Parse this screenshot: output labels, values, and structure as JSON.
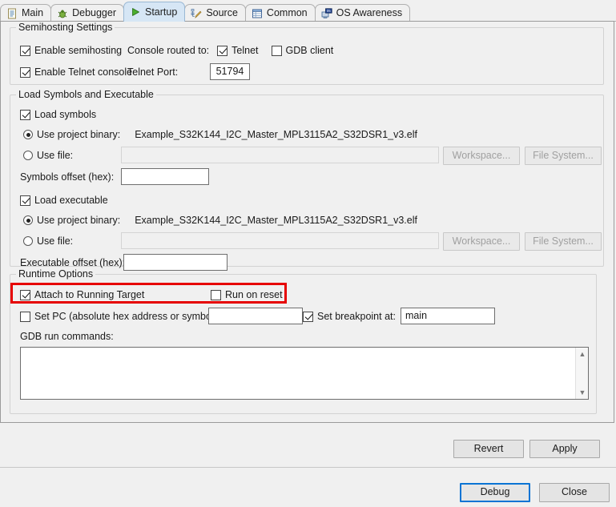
{
  "tabs": [
    {
      "label": "Main",
      "icon": "document-icon",
      "active": false
    },
    {
      "label": "Debugger",
      "icon": "bug-icon",
      "active": false
    },
    {
      "label": "Startup",
      "icon": "play-icon",
      "active": true
    },
    {
      "label": "Source",
      "icon": "source-edit-icon",
      "active": false
    },
    {
      "label": "Common",
      "icon": "table-icon",
      "active": false
    },
    {
      "label": "OS Awareness",
      "icon": "os-monitor-icon",
      "active": false
    }
  ],
  "semihosting": {
    "group_title": "Semihosting Settings",
    "enable_semihosting": {
      "label": "Enable semihosting",
      "checked": true
    },
    "enable_telnet_console": {
      "label": "Enable Telnet console",
      "checked": true
    },
    "console_routed_to_label": "Console routed to:",
    "telnet": {
      "label": "Telnet",
      "checked": true
    },
    "gdb_client": {
      "label": "GDB client",
      "checked": false
    },
    "telnet_port_label": "Telnet Port:",
    "telnet_port_value": "51794"
  },
  "load_symbols": {
    "group_title": "Load Symbols and Executable",
    "load_symbols": {
      "label": "Load symbols",
      "checked": true
    },
    "symbols_use_project_binary": {
      "label": "Use project binary:",
      "selected": true
    },
    "symbols_project_binary_value": "Example_S32K144_I2C_Master_MPL3115A2_S32DSR1_v3.elf",
    "symbols_use_file": {
      "label": "Use file:",
      "selected": false
    },
    "symbols_use_file_value": "",
    "symbols_offset_label": "Symbols offset (hex):",
    "symbols_offset_value": "",
    "load_executable": {
      "label": "Load executable",
      "checked": true
    },
    "exec_use_project_binary": {
      "label": "Use project binary:",
      "selected": true
    },
    "exec_project_binary_value": "Example_S32K144_I2C_Master_MPL3115A2_S32DSR1_v3.elf",
    "exec_use_file": {
      "label": "Use file:",
      "selected": false
    },
    "exec_use_file_value": "",
    "exec_offset_label": "Executable offset (hex):",
    "exec_offset_value": "",
    "workspace_button": "Workspace...",
    "file_system_button": "File System..."
  },
  "runtime_options": {
    "group_title": "Runtime Options",
    "attach_to_running_target": {
      "label": "Attach to Running Target",
      "checked": true
    },
    "run_on_reset": {
      "label": "Run on reset",
      "checked": false
    },
    "set_pc": {
      "label": "Set PC (absolute hex address or symbol):",
      "checked": false
    },
    "set_pc_value": "",
    "set_breakpoint_at": {
      "label": "Set breakpoint at:",
      "checked": true
    },
    "set_breakpoint_value": "main",
    "gdb_run_commands_label": "GDB run commands:",
    "gdb_run_commands_value": "",
    "highlight_color": "#e60000"
  },
  "footer": {
    "revert_button": "Revert",
    "apply_button": "Apply",
    "debug_button": "Debug",
    "close_button": "Close",
    "default_button_accent": "#0a74d4"
  }
}
